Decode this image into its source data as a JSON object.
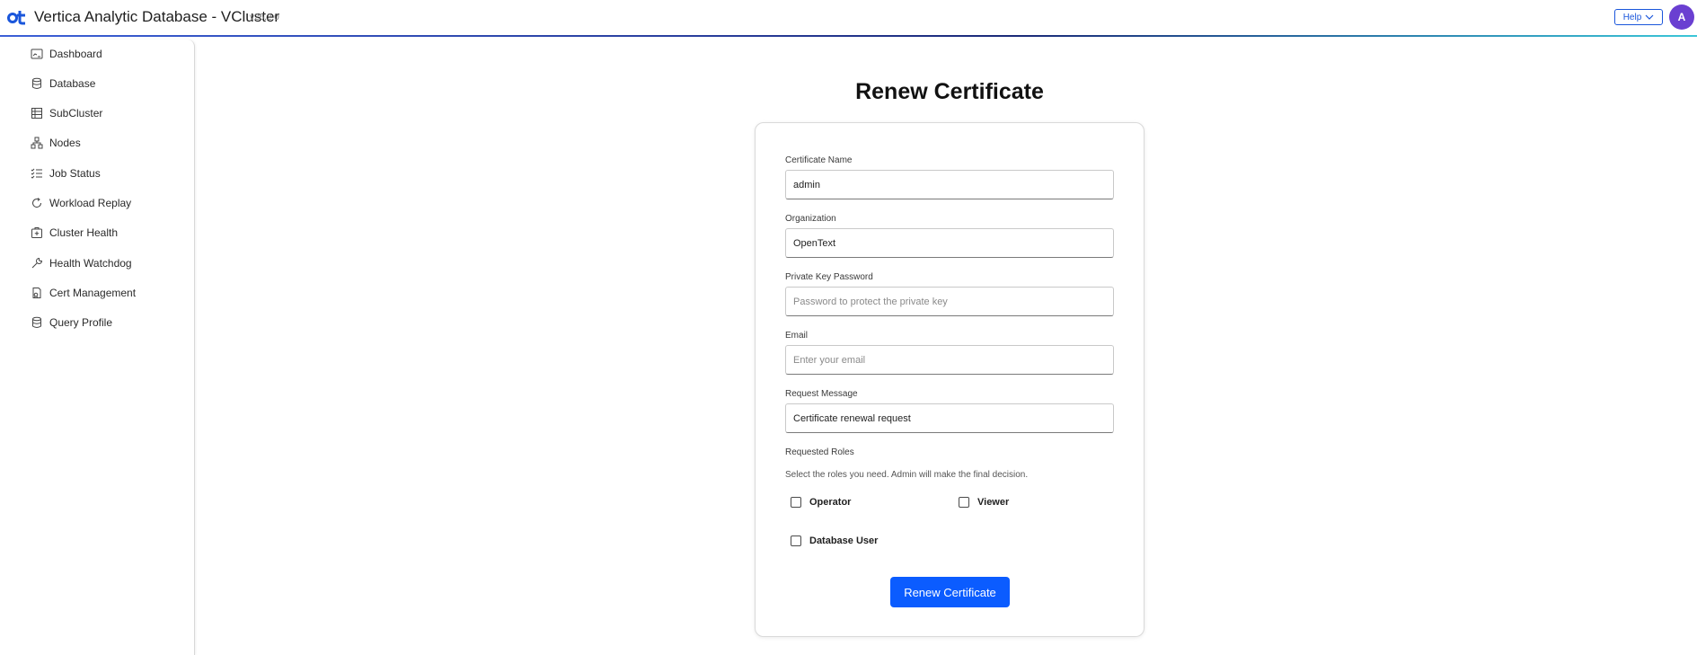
{
  "header": {
    "app_title": "Vertica Analytic Database - VCluster",
    "version": "v26.2.0",
    "help_label": "Help",
    "avatar_initial": "A",
    "brand_color": "#1a56db"
  },
  "sidebar": {
    "items": [
      {
        "label": "Dashboard",
        "icon": "dashboard-icon"
      },
      {
        "label": "Database",
        "icon": "database-icon"
      },
      {
        "label": "SubCluster",
        "icon": "subcluster-icon"
      },
      {
        "label": "Nodes",
        "icon": "nodes-icon"
      },
      {
        "label": "Job Status",
        "icon": "job-status-icon"
      },
      {
        "label": "Workload Replay",
        "icon": "replay-icon"
      },
      {
        "label": "Cluster Health",
        "icon": "cluster-health-icon"
      },
      {
        "label": "Health Watchdog",
        "icon": "wrench-icon"
      },
      {
        "label": "Cert Management",
        "icon": "certificate-icon"
      },
      {
        "label": "Query Profile",
        "icon": "database-icon"
      }
    ]
  },
  "main": {
    "title": "Renew Certificate",
    "form": {
      "certificate_name": {
        "label": "Certificate Name",
        "value": "admin"
      },
      "organization": {
        "label": "Organization",
        "value": "OpenText"
      },
      "private_key_password": {
        "label": "Private Key Password",
        "placeholder": "Password to protect the private key"
      },
      "email": {
        "label": "Email",
        "placeholder": "Enter your email"
      },
      "request_message": {
        "label": "Request Message",
        "value": "Certificate renewal request"
      },
      "roles": {
        "label": "Requested Roles",
        "help": "Select the roles you need. Admin will make the final decision.",
        "options": [
          {
            "label": "Operator",
            "checked": false
          },
          {
            "label": "Viewer",
            "checked": false
          },
          {
            "label": "Database User",
            "checked": false
          }
        ]
      },
      "submit_label": "Renew Certificate"
    }
  }
}
